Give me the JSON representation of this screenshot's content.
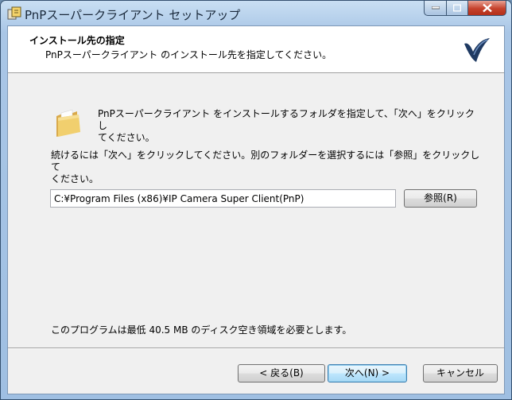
{
  "window": {
    "title": "PnPスーパークライアント セットアップ",
    "icon": "installer-icon",
    "caption_buttons": [
      "minimize-icon",
      "maximize-icon",
      "close-icon"
    ]
  },
  "header": {
    "title": "インストール先の指定",
    "subtitle": "PnPスーパークライアント のインストール先を指定してください。",
    "logo": "setup-logo-icon"
  },
  "body": {
    "folder_icon": "folder-icon",
    "instruction_line1": "PnPスーパークライアント をインストールするフォルダを指定して、「次へ」をクリックし",
    "instruction_line2": "てください。",
    "continue_line1": "続けるには「次へ」をクリックしてください。別のフォルダーを選択するには「参照」をクリックして",
    "continue_line2": "ください。",
    "install_path": "C:¥Program Files (x86)¥IP Camera Super Client(PnP)",
    "browse_label": "参照(R)",
    "space_required": "このプログラムは最低 40.5 MB のディスク空き領域を必要とします。"
  },
  "footer": {
    "back_label": "< 戻る(B)",
    "next_label": "次へ(N) >",
    "cancel_label": "キャンセル"
  },
  "colors": {
    "frame": "#a9c6e6",
    "close_button": "#c5412b",
    "focus_button": "#bee6fd"
  }
}
